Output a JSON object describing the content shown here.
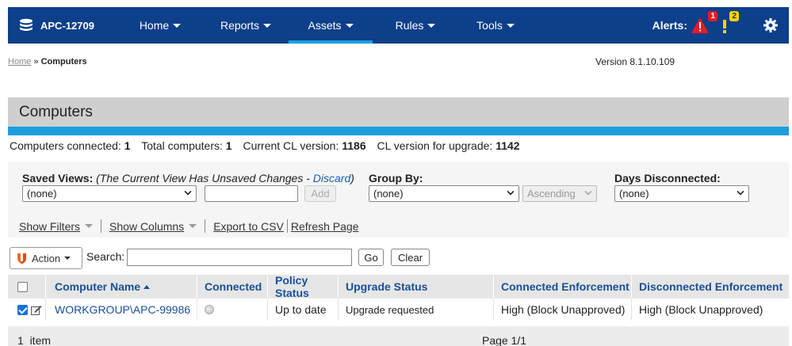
{
  "app": {
    "instance_name": "APC-12709"
  },
  "nav": {
    "items": [
      {
        "label": "Home",
        "active": false
      },
      {
        "label": "Reports",
        "active": false
      },
      {
        "label": "Assets",
        "active": true
      },
      {
        "label": "Rules",
        "active": false
      },
      {
        "label": "Tools",
        "active": false
      }
    ],
    "alerts_label": "Alerts:",
    "alert_critical_count": "1",
    "alert_warning_count": "2"
  },
  "breadcrumb": {
    "home": "Home",
    "separator": " » ",
    "current": "Computers"
  },
  "version": "Version 8.1.10.109",
  "page_title": "Computers",
  "stats": {
    "connected_label": "Computers connected:",
    "connected_value": "1",
    "total_label": "Total computers:",
    "total_value": "1",
    "current_cl_label": "Current CL version:",
    "current_cl_value": "1186",
    "upgrade_cl_label": "CL version for upgrade:",
    "upgrade_cl_value": "1142"
  },
  "filters": {
    "saved_views_label": "Saved Views:",
    "saved_views_note": "(The Current View Has Unsaved Changes - ",
    "discard_label": "Discard",
    "saved_views_note_end": ")",
    "saved_views_value": "(none)",
    "add_label": "Add",
    "group_by_label": "Group By:",
    "group_by_value": "(none)",
    "order_value": "Ascending",
    "days_disconnected_label": "Days Disconnected:",
    "days_disconnected_value": "(none)",
    "show_filters": "Show Filters",
    "show_columns": "Show Columns",
    "export_csv": "Export to CSV",
    "refresh_page": "Refresh Page"
  },
  "toolbar": {
    "action_label": "Action",
    "search_label": "Search:",
    "search_value": "",
    "go_label": "Go",
    "clear_label": "Clear"
  },
  "table": {
    "columns": [
      "Computer Name",
      "Connected",
      "Policy Status",
      "Upgrade Status",
      "Connected Enforcement",
      "Disconnected Enforcement"
    ],
    "rows": [
      {
        "checked": true,
        "computer_name": "WORKGROUP\\APC-99986",
        "connected": false,
        "policy_status": "Up to date",
        "upgrade_status": "Upgrade requested",
        "connected_enforcement": "High (Block Unapproved)",
        "disconnected_enforcement": "High (Block Unapproved)"
      }
    ],
    "item_count": "1  item",
    "page": "Page 1/1"
  },
  "colors": {
    "navbar": "#0d3f8a",
    "accent": "#1a9ede",
    "link": "#1a4f96",
    "alert_red": "#e31c23",
    "alert_yellow": "#f4d400"
  }
}
